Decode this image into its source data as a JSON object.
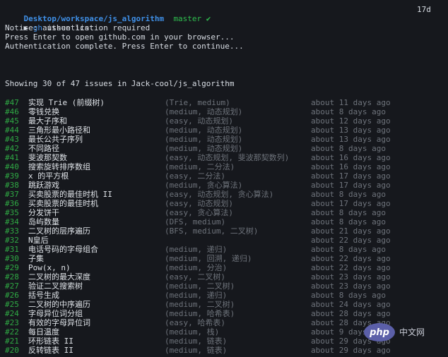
{
  "shell": {
    "cwd": "Desktop/workspace/js_algorithm",
    "branch": "master ✔",
    "age": "17d",
    "prompt_symbol": "▶",
    "command_bin": "gh",
    "command_args": " issue list"
  },
  "output": {
    "notice": "Notice: authentication required",
    "press_enter": "Press Enter to open github.com in your browser...",
    "auth_complete": "Authentication complete. Press Enter to continue...",
    "showing": "Showing 30 of 47 issues in Jack-cool/js_algorithm"
  },
  "issues": [
    {
      "num": "#47",
      "title": "实现 Trie (前缀树)",
      "labels": "(Trie, medium)",
      "time": "about 11 days ago"
    },
    {
      "num": "#46",
      "title": "零钱兑换",
      "labels": "(medium, 动态规划)",
      "time": "about 8 days ago"
    },
    {
      "num": "#45",
      "title": "最大子序和",
      "labels": "(easy, 动态规划)",
      "time": "about 12 days ago"
    },
    {
      "num": "#44",
      "title": "三角形最小路径和",
      "labels": "(medium, 动态规划)",
      "time": "about 13 days ago"
    },
    {
      "num": "#43",
      "title": "最长公共子序列",
      "labels": "(medium, 动态规划)",
      "time": "about 13 days ago"
    },
    {
      "num": "#42",
      "title": "不同路径",
      "labels": "(medium, 动态规划)",
      "time": "about 8 days ago"
    },
    {
      "num": "#41",
      "title": "斐波那契数",
      "labels": "(easy, 动态规划, 斐波那契数列)",
      "time": "about 16 days ago"
    },
    {
      "num": "#40",
      "title": "搜索旋转排序数组",
      "labels": "(medium, 二分法)",
      "time": "about 16 days ago"
    },
    {
      "num": "#39",
      "title": "x 的平方根",
      "labels": "(easy, 二分法)",
      "time": "about 17 days ago"
    },
    {
      "num": "#38",
      "title": "跳跃游戏",
      "labels": "(medium, 贪心算法)",
      "time": "about 17 days ago"
    },
    {
      "num": "#37",
      "title": "买卖股票的最佳时机 II",
      "labels": "(easy, 动态规划, 贪心算法)",
      "time": "about 8 days ago"
    },
    {
      "num": "#36",
      "title": "买卖股票的最佳时机",
      "labels": "(easy, 动态规划)",
      "time": "about 17 days ago"
    },
    {
      "num": "#35",
      "title": "分发饼干",
      "labels": "(easy, 贪心算法)",
      "time": "about 8 days ago"
    },
    {
      "num": "#34",
      "title": "岛屿数量",
      "labels": "(DFS, medium)",
      "time": "about 8 days ago"
    },
    {
      "num": "#33",
      "title": "二叉树的层序遍历",
      "labels": "(BFS, medium, 二叉树)",
      "time": "about 21 days ago"
    },
    {
      "num": "#32",
      "title": "N皇后",
      "labels": "",
      "time": "about 22 days ago"
    },
    {
      "num": "#31",
      "title": "电话号码的字母组合",
      "labels": "(medium, 递归)",
      "time": "about 8 days ago"
    },
    {
      "num": "#30",
      "title": "子集",
      "labels": "(medium, 回溯, 递归)",
      "time": "about 22 days ago"
    },
    {
      "num": "#29",
      "title": "Pow(x, n)",
      "labels": "(medium, 分治)",
      "time": "about 22 days ago"
    },
    {
      "num": "#28",
      "title": "二叉树的最大深度",
      "labels": "(easy, 二叉树)",
      "time": "about 23 days ago"
    },
    {
      "num": "#27",
      "title": "验证二叉搜索树",
      "labels": "(medium, 二叉树)",
      "time": "about 23 days ago"
    },
    {
      "num": "#26",
      "title": "括号生成",
      "labels": "(medium, 递归)",
      "time": "about 8 days ago"
    },
    {
      "num": "#25",
      "title": "二叉树的中序遍历",
      "labels": "(medium, 二叉树)",
      "time": "about 24 days ago"
    },
    {
      "num": "#24",
      "title": "字母异位词分组",
      "labels": "(medium, 哈希表)",
      "time": "about 28 days ago"
    },
    {
      "num": "#23",
      "title": "有效的字母异位词",
      "labels": "(easy, 哈希表)",
      "time": "about 28 days ago"
    },
    {
      "num": "#22",
      "title": "每日温度",
      "labels": "(medium, 栈)",
      "time": "about 9 days ago"
    },
    {
      "num": "#21",
      "title": "环形链表 II",
      "labels": "(medium, 链表)",
      "time": "about 29 days ago"
    },
    {
      "num": "#20",
      "title": "反转链表 II",
      "labels": "(medium, 链表)",
      "time": "about 29 days ago"
    }
  ],
  "watermark": {
    "logo_text": "php",
    "site_text": "中文网"
  },
  "colors": {
    "background": "#16181d",
    "path": "#3f8fe6",
    "branch": "#2fbf4f",
    "issue_number": "#2fa944",
    "muted": "#6e737b",
    "text": "#d8dde4"
  }
}
